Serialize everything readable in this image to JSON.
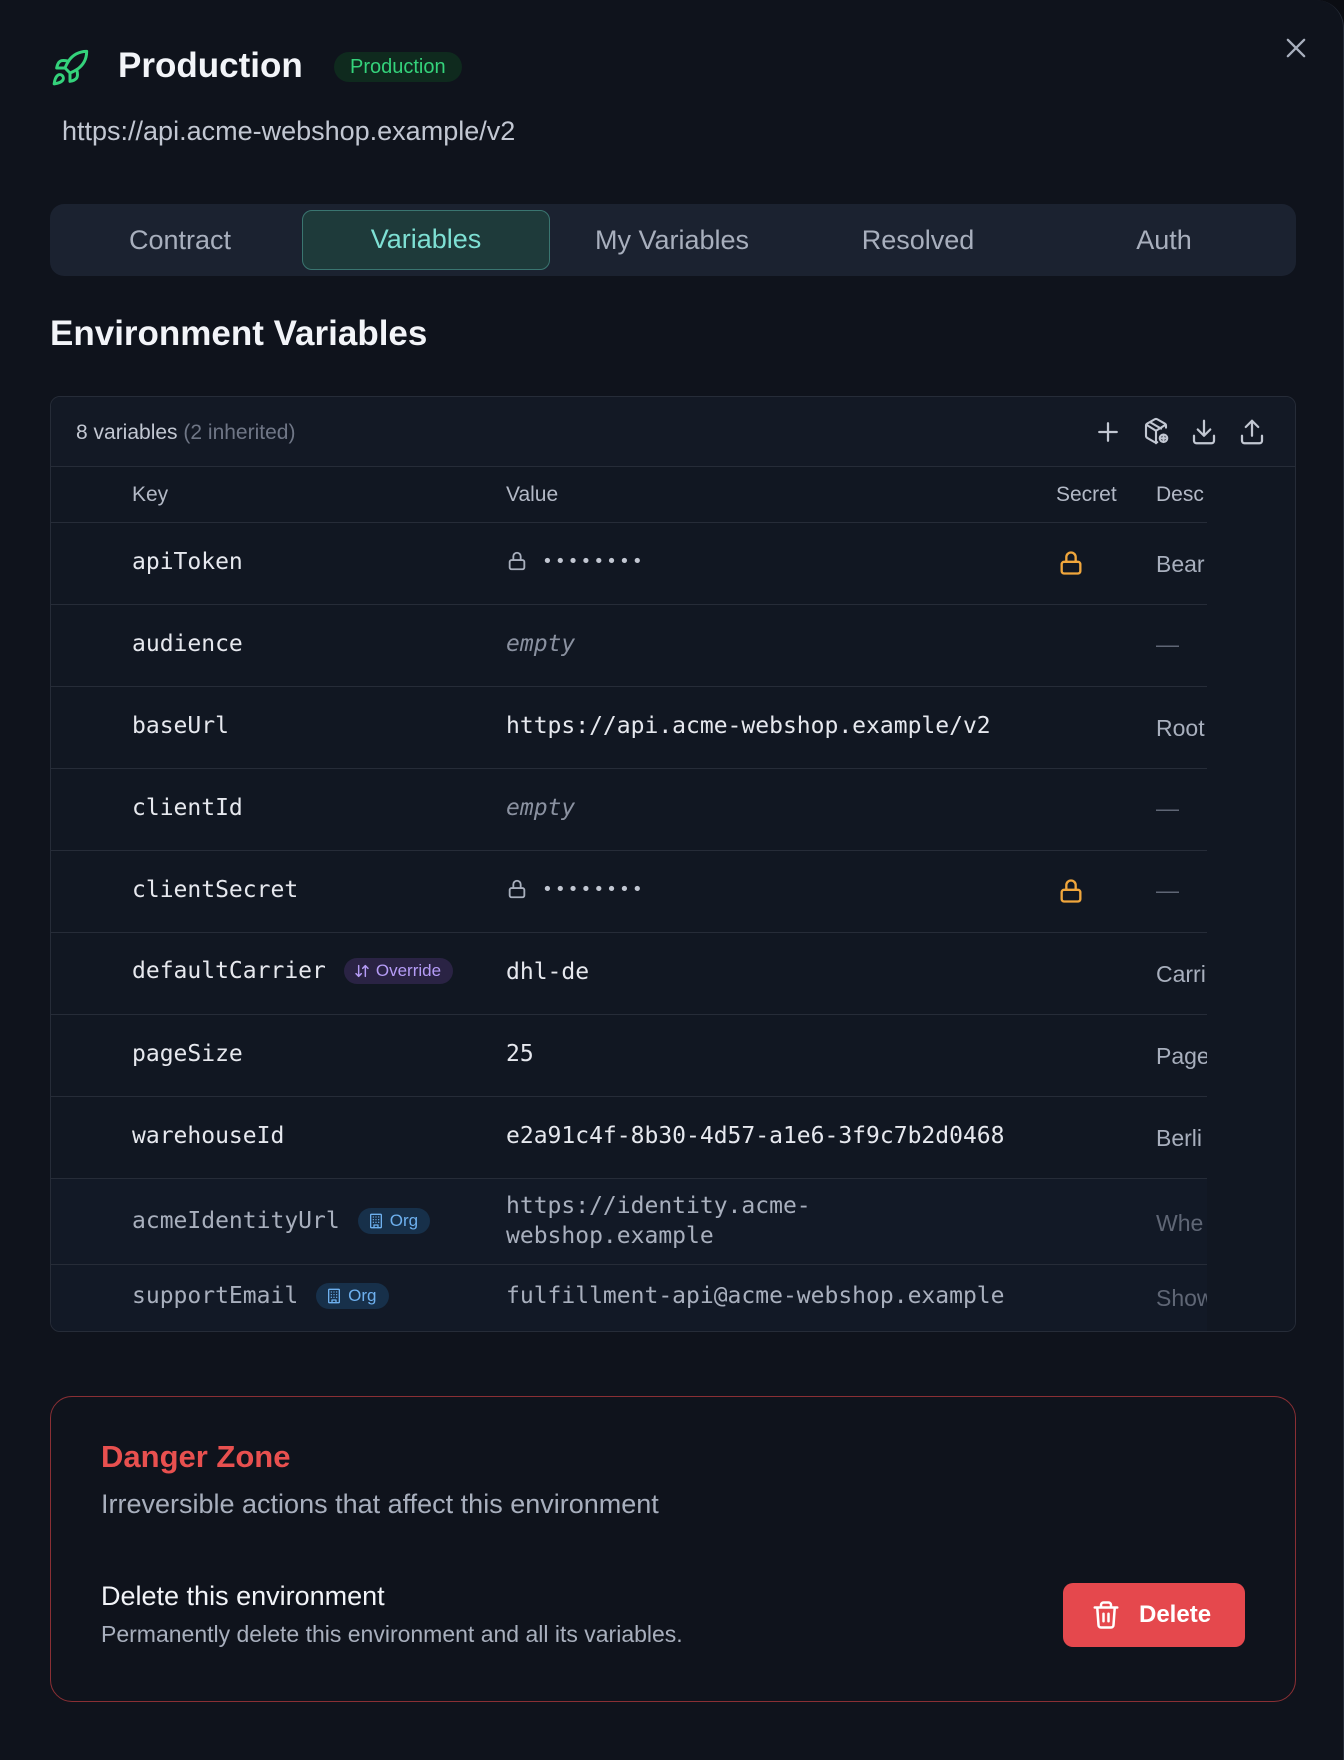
{
  "header": {
    "title": "Production",
    "badge": "Production",
    "base_url": "https://api.acme-webshop.example/v2",
    "icon": "rocket-icon",
    "accent_color": "#34d27b"
  },
  "tabs": [
    {
      "label": "Contract",
      "active": false
    },
    {
      "label": "Variables",
      "active": true
    },
    {
      "label": "My Variables",
      "active": false
    },
    {
      "label": "Resolved",
      "active": false
    },
    {
      "label": "Auth",
      "active": false
    }
  ],
  "section_title": "Environment Variables",
  "table": {
    "count_text": "8 variables",
    "inherited_text": "(2 inherited)",
    "columns": [
      "Key",
      "Value",
      "Secret",
      "Desc"
    ],
    "rows": [
      {
        "key": "apiToken",
        "value": "••••••••",
        "secret": true,
        "desc": "Bear"
      },
      {
        "key": "audience",
        "value": "empty",
        "empty": true,
        "desc": "—"
      },
      {
        "key": "baseUrl",
        "value": "https://api.acme-webshop.example/v2",
        "desc": "Root"
      },
      {
        "key": "clientId",
        "value": "empty",
        "empty": true,
        "desc": "—"
      },
      {
        "key": "clientSecret",
        "value": "••••••••",
        "secret": true,
        "desc": "—"
      },
      {
        "key": "defaultCarrier",
        "badge": "Override",
        "value": "dhl-de",
        "desc": "Carri"
      },
      {
        "key": "pageSize",
        "value": "25",
        "desc": "Page"
      },
      {
        "key": "warehouseId",
        "value": "e2a91c4f-8b30-4d57-a1e6-3f9c7b2d0468",
        "desc": "Berli"
      },
      {
        "key": "acmeIdentityUrl",
        "badge": "Org",
        "value": "https://identity.acme-webshop.example",
        "desc": "Whe"
      },
      {
        "key": "supportEmail",
        "badge": "Org",
        "value": "fulfillment-api@acme-webshop.example",
        "desc": "Show"
      }
    ]
  },
  "danger_zone": {
    "title": "Danger Zone",
    "subtitle": "Irreversible actions that affect this environment",
    "delete_title": "Delete this environment",
    "delete_desc": "Permanently delete this environment and all its variables.",
    "delete_label": "Delete",
    "color": "#e5484d"
  }
}
